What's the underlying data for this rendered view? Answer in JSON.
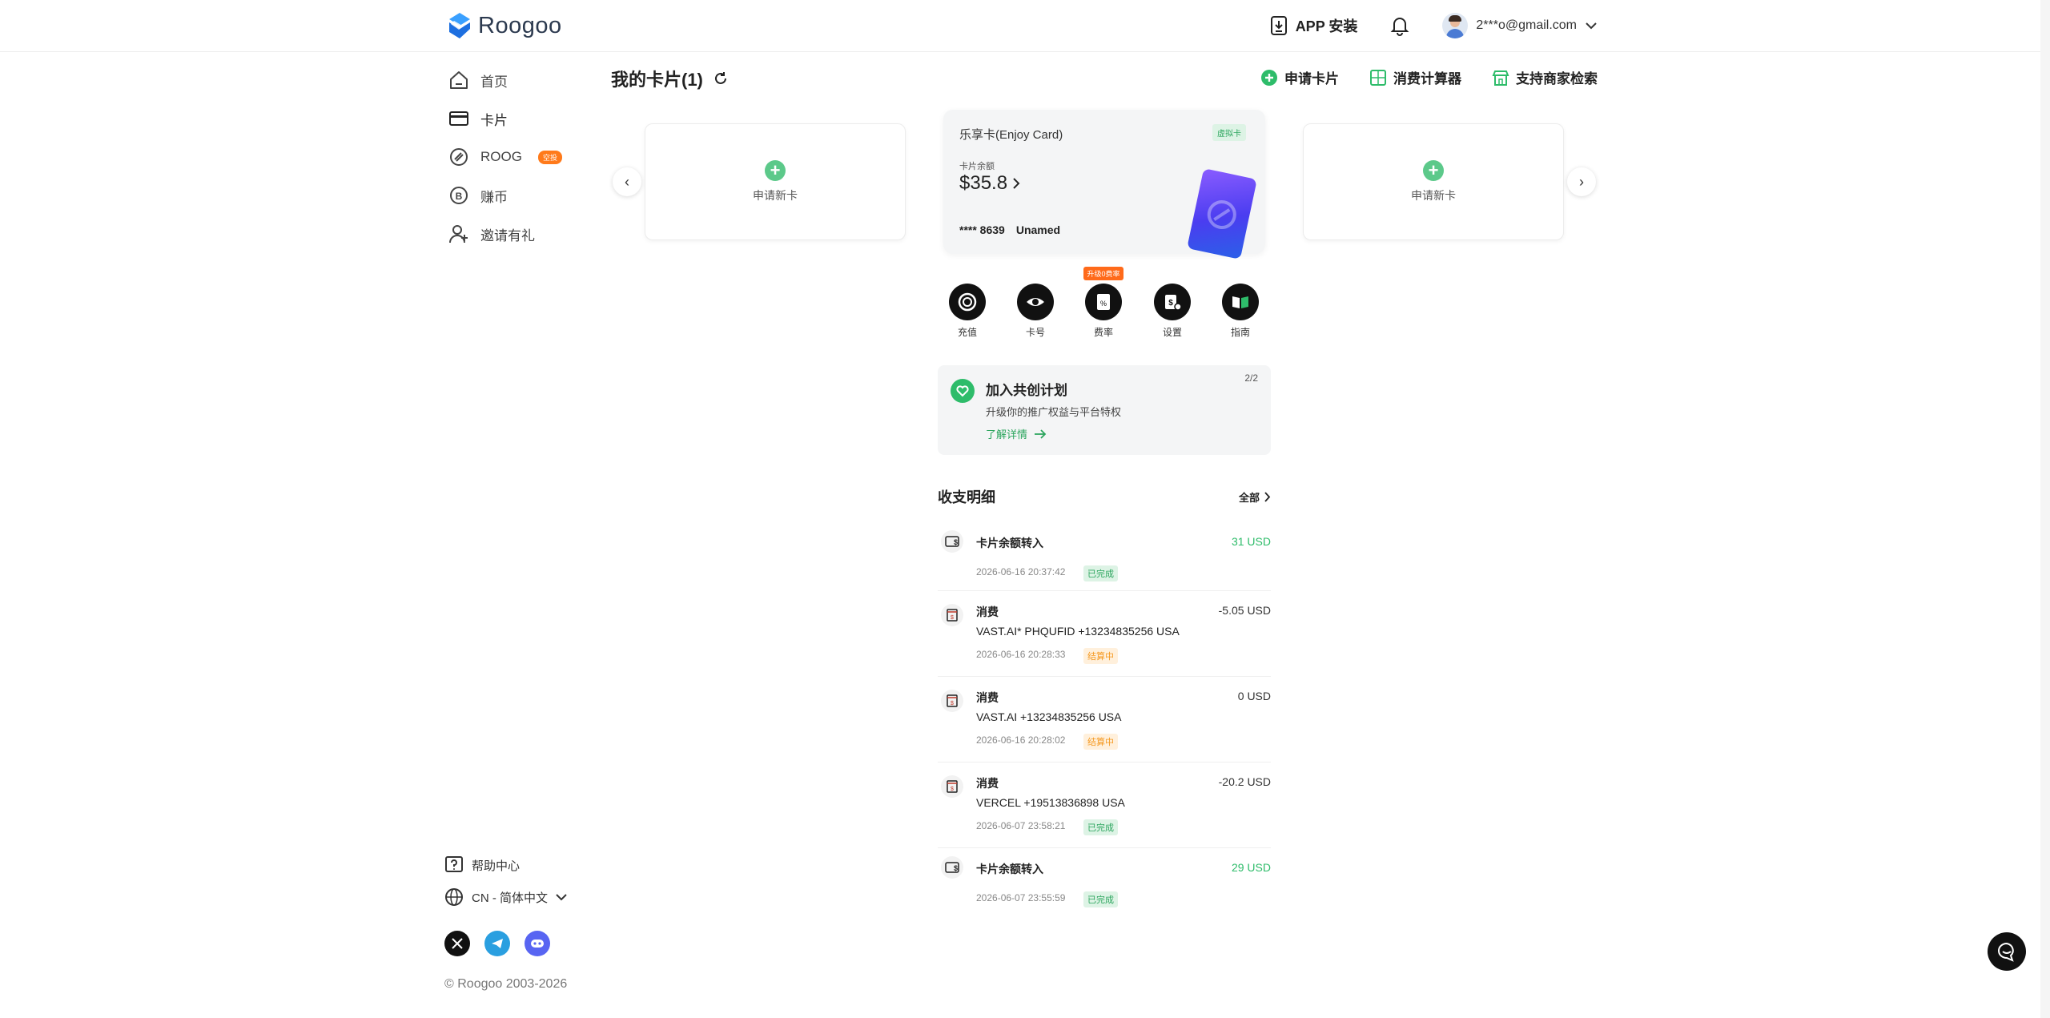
{
  "header": {
    "brand": "Roogoo",
    "app_install": "APP 安装",
    "user_email": "2***o@gmail.com"
  },
  "sidebar": {
    "items": [
      {
        "label": "首页",
        "icon": "home-icon"
      },
      {
        "label": "卡片",
        "icon": "card-icon"
      },
      {
        "label": "ROOG",
        "icon": "roog-icon",
        "badge": "空投"
      },
      {
        "label": "赚币",
        "icon": "earn-coin-icon"
      },
      {
        "label": "邀请有礼",
        "icon": "invite-user-icon"
      }
    ],
    "help": "帮助中心",
    "language": "CN - 简体中文",
    "copyright": "© Roogoo 2003-2026"
  },
  "page": {
    "title": "我的卡片(1)"
  },
  "actions": {
    "apply_card": "申请卡片",
    "calculator": "消费计算器",
    "merchant_search": "支持商家检索"
  },
  "carousel": {
    "new_card_label": "申请新卡"
  },
  "card": {
    "name": "乐享卡(Enjoy Card)",
    "type_tag": "虚拟卡",
    "balance_label": "卡片余额",
    "balance": "$35.8",
    "masked_number": "**** 8639",
    "holder": "Unamed"
  },
  "quick_actions": [
    {
      "label": "充值",
      "icon": "recharge-icon"
    },
    {
      "label": "卡号",
      "icon": "eye-icon"
    },
    {
      "label": "费率",
      "icon": "fee-rate-icon",
      "tag": "升级0费率"
    },
    {
      "label": "设置",
      "icon": "settings-icon"
    },
    {
      "label": "指南",
      "icon": "guide-icon"
    }
  ],
  "promo": {
    "title": "加入共创计划",
    "subtitle": "升级你的推广权益与平台特权",
    "link": "了解详情",
    "counter": "2/2"
  },
  "transactions": {
    "title": "收支明细",
    "all_label": "全部",
    "items": [
      {
        "type": "卡片余额转入",
        "merchant": "",
        "date": "2026-06-16 20:37:42",
        "status": "已完成",
        "status_kind": "done",
        "amount": "31 USD",
        "positive": true
      },
      {
        "type": "消费",
        "merchant": "VAST.AI* PHQUFID +13234835256 USA",
        "date": "2026-06-16 20:28:33",
        "status": "结算中",
        "status_kind": "pending",
        "amount": "-5.05 USD",
        "positive": false
      },
      {
        "type": "消费",
        "merchant": "VAST.AI +13234835256 USA",
        "date": "2026-06-16 20:28:02",
        "status": "结算中",
        "status_kind": "pending",
        "amount": "0 USD",
        "positive": false
      },
      {
        "type": "消费",
        "merchant": "VERCEL +19513836898 USA",
        "date": "2026-06-07 23:58:21",
        "status": "已完成",
        "status_kind": "done",
        "amount": "-20.2 USD",
        "positive": false
      },
      {
        "type": "卡片余额转入",
        "merchant": "",
        "date": "2026-06-07 23:55:59",
        "status": "已完成",
        "status_kind": "done",
        "amount": "29 USD",
        "positive": true
      }
    ]
  },
  "colors": {
    "accent_green": "#2ebc6a",
    "pending_orange": "#f59a23",
    "promo_orange": "#ff6a1a"
  }
}
